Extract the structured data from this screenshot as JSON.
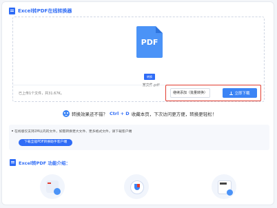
{
  "header": {
    "title": "Excel转PDF在线转换器",
    "icon": "document-icon"
  },
  "upload": {
    "file_icon_label": "PDF",
    "file_badge": "转换",
    "file_name": "某文件.pdf",
    "status": "已上传1个文件，共31.67K。",
    "save_button": "继续添加（批量转换）",
    "download_button": "立即下载",
    "highlight_color": "#e23b2e"
  },
  "rating": {
    "before": "转换效果还不错？",
    "shortcut": "Ctrl + D",
    "after": "收藏本页，下次访问更方便，转换更轻松！"
  },
  "notice": {
    "text": "在线版仅支持2M以内的文件，如需转换更大文件、更多格式文件，请下载客户端",
    "button": "下载全能PDF转换助手客户端"
  },
  "intro": {
    "title": "Excel转PDF 功能介绍："
  },
  "colors": {
    "accent": "#2f6cf6",
    "primary_button": "#3b84f5"
  }
}
